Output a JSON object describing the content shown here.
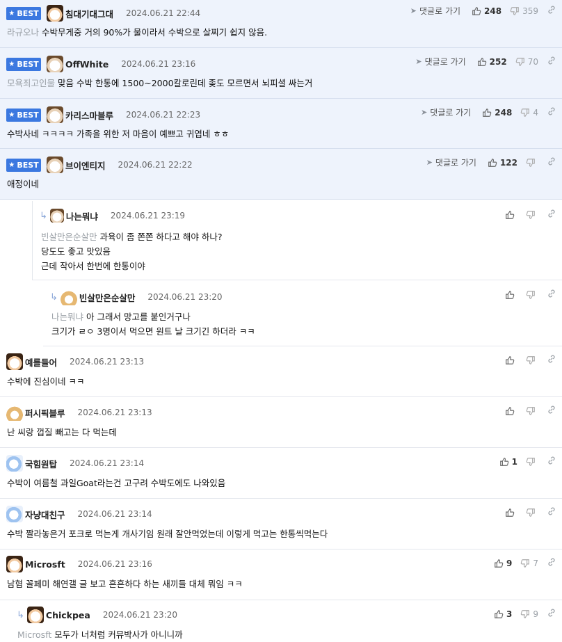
{
  "labels": {
    "best": "BEST",
    "goto": "댓글로 가기"
  },
  "colors": {
    "best_badge": "#3b78e0",
    "best_bg": "#eef3fc",
    "mention": "#9aa0a6"
  },
  "comments": [
    {
      "best": true,
      "nick": "침대기대그대",
      "avatar": "bear",
      "date": "2024.06.21 22:44",
      "mention": "라규오나",
      "lines": [
        "수박무게중 거의 90%가 물이라서 수박으로 살찌기 쉽지 않음."
      ],
      "up": "248",
      "down": "359"
    },
    {
      "best": true,
      "nick": "OffWhite",
      "avatar": "dog",
      "date": "2024.06.21 23:16",
      "mention": "모욕죄고인물",
      "lines": [
        "맞음 수박 한통에 1500~2000칼로린데 좆도 모르면서 뇌피셜 싸는거"
      ],
      "up": "252",
      "down": "70"
    },
    {
      "best": true,
      "nick": "카리스마블루",
      "avatar": "dog",
      "date": "2024.06.21 22:23",
      "mention": "",
      "lines": [
        "수박사네 ㅋㅋㅋㅋ 가족을 위한 저 마음이 예쁘고 귀엽네 ㅎㅎ"
      ],
      "up": "248",
      "down": "4"
    },
    {
      "best": true,
      "nick": "브이엔티지",
      "avatar": "dog",
      "date": "2024.06.21 22:22",
      "mention": "",
      "lines": [
        "애정이네"
      ],
      "up": "122",
      "down": ""
    },
    {
      "best": false,
      "nick": "나는뭐냐",
      "avatar": "dog",
      "date": "2024.06.21 23:19",
      "mention": "빈살만은순살만",
      "lines": [
        "과육이 좀 쫀쫀 하다고 해야 하나?",
        "당도도 좋고 맛있음",
        "근데 작아서 한번에 한통이야"
      ],
      "up": "",
      "down": ""
    },
    {
      "best": false,
      "nick": "빈살만은순살만",
      "avatar": "fox",
      "date": "2024.06.21 23:20",
      "mention": "나는뭐냐",
      "lines": [
        "아 그래서 망고를 붙인거구나",
        "크기가 ㄹㅇ 3명이서 먹으면 원트 날 크기긴 하더라 ㅋㅋ"
      ],
      "up": "",
      "down": ""
    },
    {
      "best": false,
      "nick": "예를들어",
      "avatar": "bear",
      "date": "2024.06.21 23:13",
      "mention": "",
      "lines": [
        "수박에 진심이네 ㅋㅋ"
      ],
      "up": "",
      "down": ""
    },
    {
      "best": false,
      "nick": "퍼시픽블루",
      "avatar": "fox",
      "date": "2024.06.21 23:13",
      "mention": "",
      "lines": [
        "난 씨랑 껍질 빼고는 다 먹는데"
      ],
      "up": "",
      "down": ""
    },
    {
      "best": false,
      "nick": "국힘원탑",
      "avatar": "blue",
      "date": "2024.06.21 23:14",
      "mention": "",
      "lines": [
        "수박이 여름철 과일Goat라는건 고구려 수박도에도 나와있음"
      ],
      "up": "1",
      "down": ""
    },
    {
      "best": false,
      "nick": "자냥대친구",
      "avatar": "blue",
      "date": "2024.06.21 23:14",
      "mention": "",
      "lines": [
        "수박 짤라놓은거 포크로 먹는게 개사기임 원래 잘안먹었는데 이렇게 먹고는 한통씩먹는다"
      ],
      "up": "",
      "down": ""
    },
    {
      "best": false,
      "nick": "Microsft",
      "avatar": "bear",
      "date": "2024.06.21 23:16",
      "mention": "",
      "lines": [
        "남혐 꼴페미 해연갤 글 보고 흔흔하다 하는 새끼들 대체 뭐임 ㅋㅋ"
      ],
      "up": "9",
      "down": "7"
    },
    {
      "best": false,
      "nick": "Chickpea",
      "avatar": "bear",
      "date": "2024.06.21 23:20",
      "mention": "Microsft",
      "lines": [
        "모두가 너처럼 커뮤박사가 아니니까"
      ],
      "up": "3",
      "down": "9"
    }
  ]
}
